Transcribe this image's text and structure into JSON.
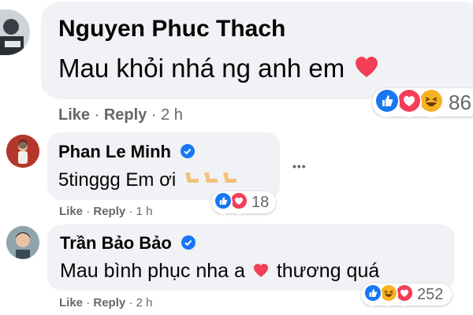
{
  "comments": [
    {
      "author": "Nguyen Phuc Thach",
      "verified": false,
      "text_before": "Mau khỏi nhá ng anh em",
      "text_after": "",
      "inline_icon": "heart-icon",
      "like_label": "Like",
      "reply_label": "Reply",
      "time": "2 h",
      "reactions": [
        "like-reaction-icon",
        "love-reaction-icon",
        "haha-reaction-icon"
      ],
      "reaction_count": "86"
    },
    {
      "author": "Phan Le Minh",
      "verified": true,
      "text_before": "5tinggg Em ơi",
      "text_after": "",
      "inline_icon": "leg-emoji-icon",
      "like_label": "Like",
      "reply_label": "Reply",
      "time": "1 h",
      "reactions": [
        "like-reaction-icon",
        "love-reaction-icon"
      ],
      "reaction_count": "18",
      "more_label": "•••"
    },
    {
      "author": "Trần Bảo Bảo",
      "verified": true,
      "text_before": "Mau bình phục nha a",
      "text_after": "thương quá",
      "inline_icon": "heart-icon",
      "like_label": "Like",
      "reply_label": "Reply",
      "time": "2 h",
      "reactions": [
        "like-reaction-icon",
        "haha-reaction-icon",
        "love-reaction-icon"
      ],
      "reaction_count": "252"
    }
  ],
  "colors": {
    "bubble": "#f0f2f5",
    "meta_text": "#65676b",
    "like_blue": "#1877f2",
    "love_red": "#f33e58",
    "haha_yellow": "#f7b125",
    "verified_blue": "#1877f2"
  }
}
